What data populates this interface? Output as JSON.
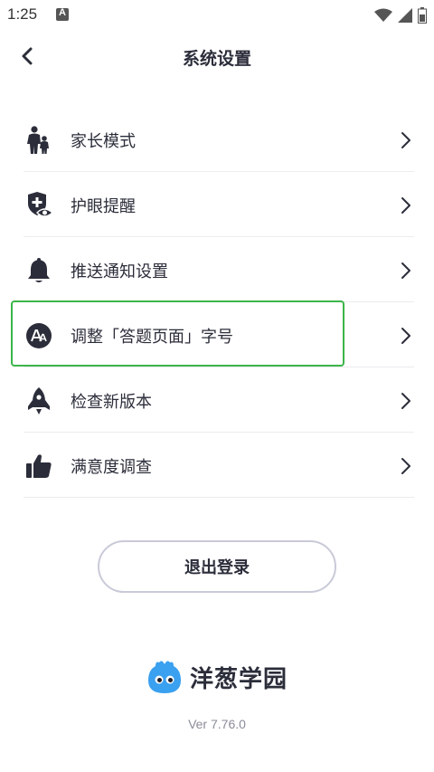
{
  "status_bar": {
    "time": "1:25",
    "notification_icon": "a-icon",
    "wifi_icon": "wifi-icon",
    "signal_icon": "signal-icon",
    "battery_icon": "battery-icon"
  },
  "nav": {
    "back_icon": "chevron-left-icon",
    "title": "系统设置"
  },
  "menu": {
    "items": [
      {
        "label": "家长模式",
        "icon": "parent-child-icon"
      },
      {
        "label": "护眼提醒",
        "icon": "eye-shield-icon"
      },
      {
        "label": "推送通知设置",
        "icon": "bell-icon"
      },
      {
        "label": "调整「答题页面」字号",
        "icon": "font-size-icon"
      },
      {
        "label": "检查新版本",
        "icon": "rocket-icon"
      },
      {
        "label": "满意度调查",
        "icon": "thumbs-up-icon"
      }
    ],
    "highlighted_index": 3
  },
  "logout": {
    "label": "退出登录"
  },
  "brand": {
    "name": "洋葱学园",
    "logo_icon": "onion-mascot-icon"
  },
  "version": "Ver 7.76.0",
  "colors": {
    "text": "#2b2d3a",
    "highlight": "#3cb54a",
    "divider": "#ececef",
    "mascot": "#3aa0f0"
  }
}
